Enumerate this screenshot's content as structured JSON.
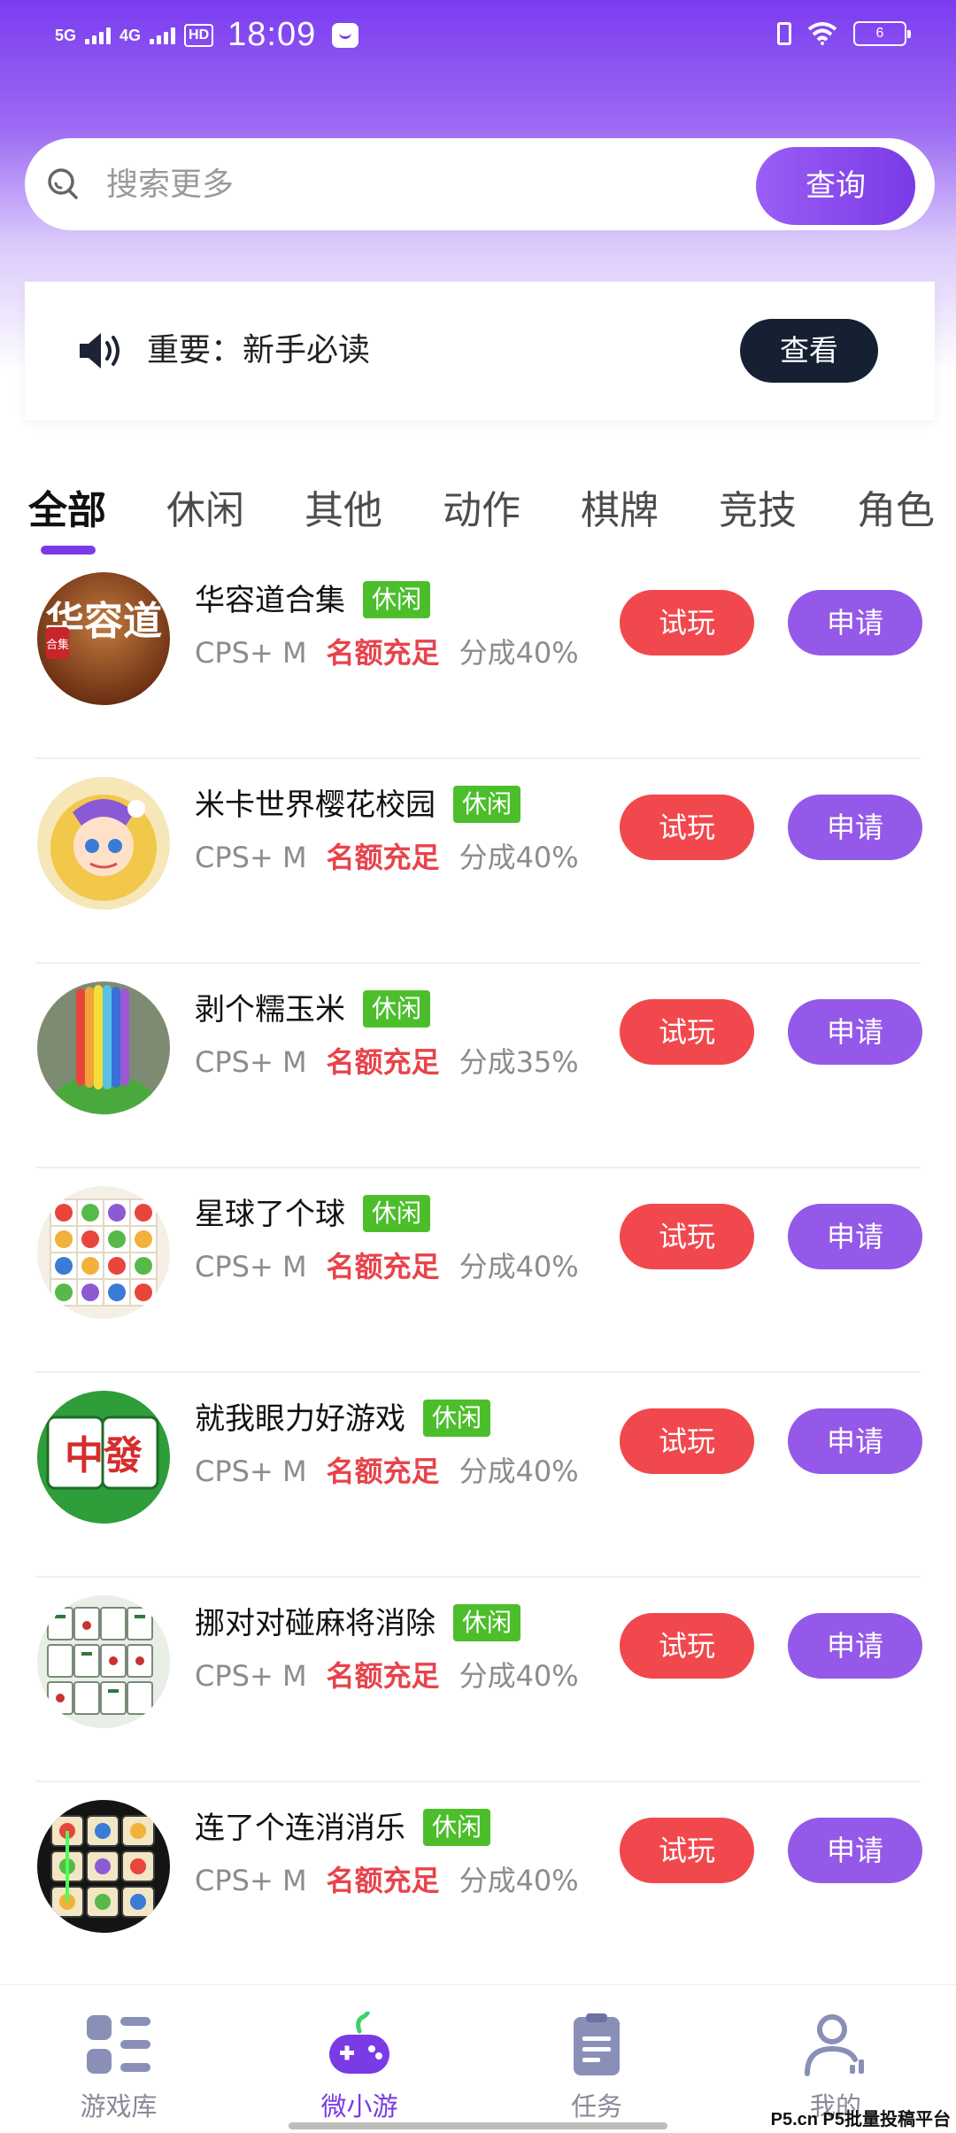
{
  "status_bar": {
    "network1": "5G",
    "network2": "4G",
    "hd": "HD",
    "time": "18:09",
    "battery": "6"
  },
  "search": {
    "placeholder": "搜索更多",
    "button_label": "查询"
  },
  "notice": {
    "text": "重要：新手必读",
    "button_label": "查看"
  },
  "tabs": [
    "全部",
    "休闲",
    "其他",
    "动作",
    "棋牌",
    "竞技",
    "角色"
  ],
  "games": [
    {
      "name": "华容道合集",
      "tag": "休闲",
      "cps": "CPS+ M",
      "quota": "名额充足",
      "share": "分成40%",
      "try": "试玩",
      "apply": "申请"
    },
    {
      "name": "米卡世界樱花校园",
      "tag": "休闲",
      "cps": "CPS+ M",
      "quota": "名额充足",
      "share": "分成40%",
      "try": "试玩",
      "apply": "申请"
    },
    {
      "name": "剥个糯玉米",
      "tag": "休闲",
      "cps": "CPS+ M",
      "quota": "名额充足",
      "share": "分成35%",
      "try": "试玩",
      "apply": "申请"
    },
    {
      "name": "星球了个球",
      "tag": "休闲",
      "cps": "CPS+ M",
      "quota": "名额充足",
      "share": "分成40%",
      "try": "试玩",
      "apply": "申请"
    },
    {
      "name": "就我眼力好游戏",
      "tag": "休闲",
      "cps": "CPS+ M",
      "quota": "名额充足",
      "share": "分成40%",
      "try": "试玩",
      "apply": "申请"
    },
    {
      "name": "挪对对碰麻将消除",
      "tag": "休闲",
      "cps": "CPS+ M",
      "quota": "名额充足",
      "share": "分成40%",
      "try": "试玩",
      "apply": "申请"
    },
    {
      "name": "连了个连消消乐",
      "tag": "休闲",
      "cps": "CPS+ M",
      "quota": "名额充足",
      "share": "分成40%",
      "try": "试玩",
      "apply": "申请"
    }
  ],
  "icon_texts": {
    "huarongdao": "华容道",
    "huarongdao_badge": "合集",
    "mahjong": "中發"
  },
  "bottom_nav": [
    {
      "label": "游戏库",
      "icon": "library-icon"
    },
    {
      "label": "微小游",
      "icon": "gamepad-icon"
    },
    {
      "label": "任务",
      "icon": "clipboard-icon"
    },
    {
      "label": "我的",
      "icon": "user-icon"
    }
  ],
  "watermark": "P5.cn P5批量投稿平台",
  "colors": {
    "brand": "#7a3ae6",
    "try": "#f1484d",
    "apply": "#9459e8",
    "tag": "#4cbe2c",
    "quota": "#e8434b"
  }
}
